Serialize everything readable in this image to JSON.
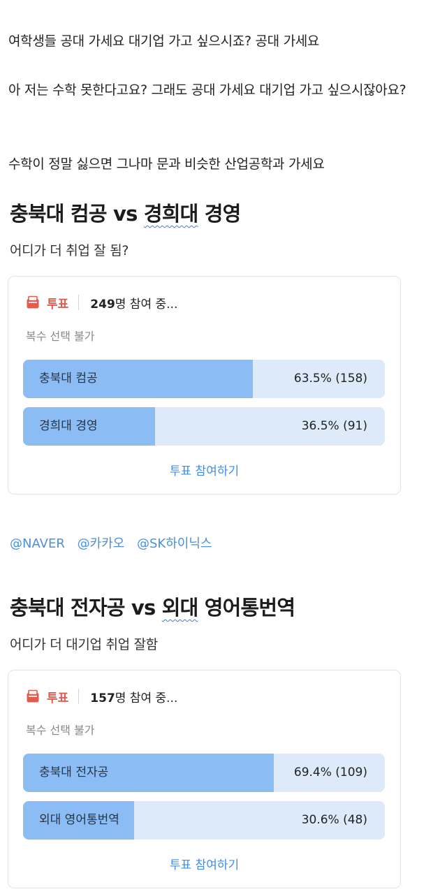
{
  "intro": {
    "line1": "여학생들 공대 가세요 대기업 가고 싶으시죠? 공대 가세요",
    "line2": "아 저는 수학 못한다고요? 그래도 공대 가세요 대기업 가고 싶으시잖아요?",
    "line3": "수학이 정말 싫으면 그나마 문과 비슷한 산업공학과 가세요"
  },
  "posts": [
    {
      "title_a": "충북대 컴공 vs ",
      "title_b": "경희대",
      "title_c": " 경영",
      "subtitle": "어디가 더 취업 잘 됨?",
      "poll": {
        "label": "투표",
        "count": "249",
        "count_suffix": "명 참여 중...",
        "multi": "복수 선택 불가",
        "options": [
          {
            "name": "충북대 컴공",
            "result": "63.5% (158)",
            "fraction": 0.635
          },
          {
            "name": "경희대 경영",
            "result": "36.5% (91)",
            "fraction": 0.365
          }
        ],
        "join": "투표 참여하기"
      }
    },
    {
      "title_a": "충북대 전자공 vs ",
      "title_b": "외대",
      "title_c": " 영어통번역",
      "subtitle": "어디가 더 대기업 취업 잘함",
      "poll": {
        "label": "투표",
        "count": "157",
        "count_suffix": "명 참여 중...",
        "multi": "복수 선택 불가",
        "options": [
          {
            "name": "충북대 전자공",
            "result": "69.4% (109)",
            "fraction": 0.694
          },
          {
            "name": "외대 영어통번역",
            "result": "30.6% (48)",
            "fraction": 0.306
          }
        ],
        "join": "투표 참여하기"
      }
    }
  ],
  "tags": [
    "@NAVER",
    "@카카오",
    "@SK하이닉스"
  ],
  "colors": {
    "accent_red": "#e25b4f",
    "bar_fill": "#8bbcf4",
    "bar_bg": "#dceaf9",
    "link": "#3c8cf0",
    "tag": "#4a90d9"
  },
  "icons": {
    "vote": "ballot-box-icon"
  }
}
